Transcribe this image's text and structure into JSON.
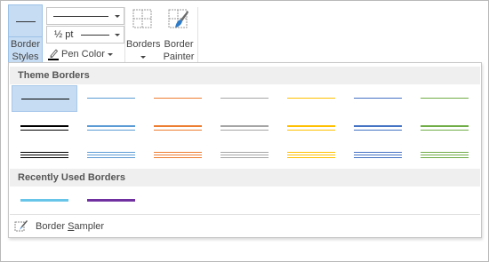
{
  "ribbon": {
    "border_styles": {
      "line1": "Border",
      "line2": "Styles"
    },
    "weight_value": "½ pt",
    "pen_color_label": "Pen Color",
    "borders_label": "Borders",
    "painter": {
      "line1": "Border",
      "line2": "Painter"
    }
  },
  "gallery": {
    "theme_header": "Theme Borders",
    "recent_header": "Recently Used Borders",
    "sampler": {
      "prefix": "Border ",
      "underlined": "S",
      "suffix": "ampler"
    },
    "theme_colors": [
      "#000000",
      "#5b9bd5",
      "#ed7d31",
      "#a5a5a5",
      "#ffc000",
      "#4472c4",
      "#70ad47"
    ],
    "recent_colors": [
      "#67c5ea",
      "#7030a0"
    ],
    "selected_swatch": "theme-row1-col1"
  }
}
